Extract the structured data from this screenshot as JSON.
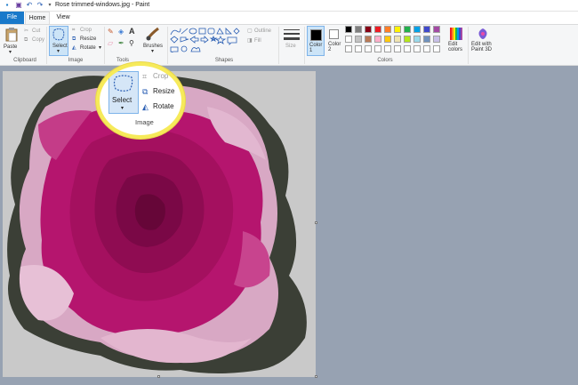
{
  "window": {
    "title": "Rose trimmed-windows.jpg - Paint",
    "quick_access": [
      "save-icon",
      "undo-icon",
      "redo-icon",
      "customize-icon"
    ]
  },
  "tabs": {
    "file": "File",
    "home": "Home",
    "view": "View"
  },
  "ribbon": {
    "clipboard": {
      "label": "Clipboard",
      "paste": "Paste",
      "cut": "Cut",
      "copy": "Copy"
    },
    "image": {
      "label": "Image",
      "select": "Select",
      "crop": "Crop",
      "resize": "Resize",
      "rotate": "Rotate"
    },
    "tools": {
      "label": "Tools"
    },
    "brushes": {
      "label": "Brushes"
    },
    "shapes": {
      "label": "Shapes",
      "outline": "Outline",
      "fill": "Fill"
    },
    "size": {
      "label": "Size"
    },
    "colors": {
      "label": "Colors",
      "color1": "Color\n1",
      "color2": "Color\n2",
      "edit_colors": "Edit\ncolors",
      "edit_paint3d": "Edit with\nPaint 3D",
      "palette_row1": [
        "#000000",
        "#7f7f7f",
        "#880015",
        "#ed1c24",
        "#ff7f27",
        "#fff200",
        "#22b14c",
        "#00a2e8",
        "#3f48cc",
        "#a349a4"
      ],
      "palette_row2": [
        "#ffffff",
        "#c3c3c3",
        "#b97a57",
        "#ffaec9",
        "#ffc90e",
        "#efe4b0",
        "#b5e61d",
        "#99d9ea",
        "#7092be",
        "#c8bfe7"
      ],
      "palette_row3": [
        "#ffffff",
        "#ffffff",
        "#ffffff",
        "#ffffff",
        "#ffffff",
        "#ffffff",
        "#ffffff",
        "#ffffff",
        "#ffffff",
        "#ffffff"
      ],
      "color1_value": "#000000",
      "color2_value": "#ffffff"
    }
  },
  "callout": {
    "select": "Select",
    "crop": "Crop",
    "resize": "Resize",
    "rotate": "Rotate",
    "group_label": "Image"
  },
  "colors": {
    "accent": "#1979ca",
    "callout_ring": "#f6ea5a",
    "workspace": "#97a2b2"
  }
}
